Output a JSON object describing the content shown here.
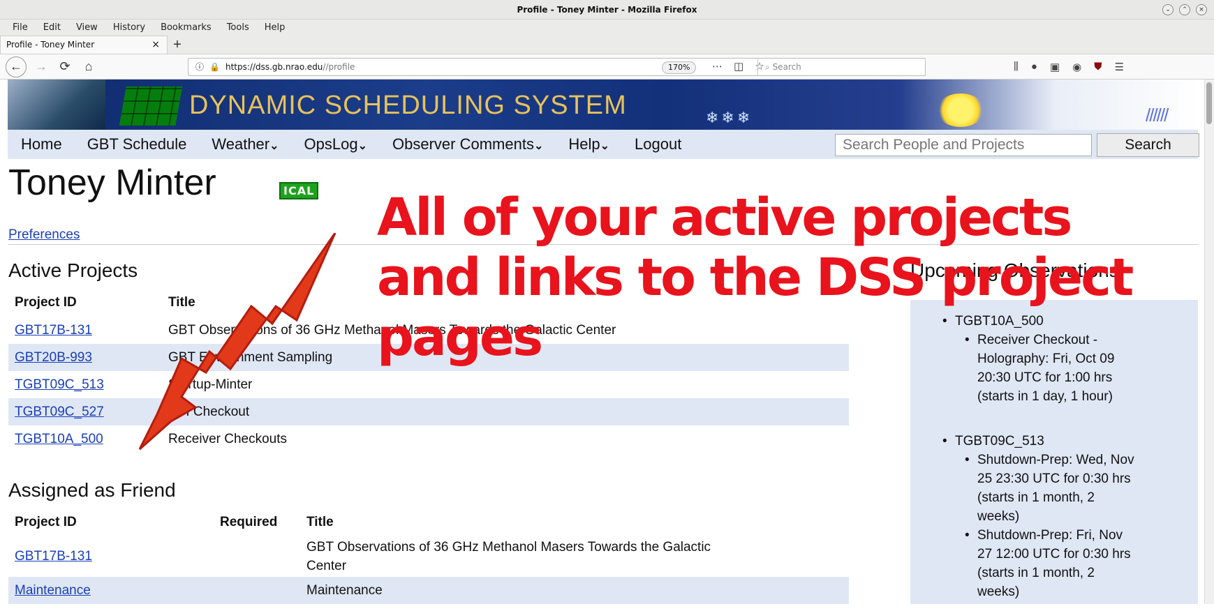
{
  "window": {
    "title": "Profile - Toney Minter - Mozilla Firefox"
  },
  "menubar": [
    "File",
    "Edit",
    "View",
    "History",
    "Bookmarks",
    "Tools",
    "Help"
  ],
  "tab": {
    "label": "Profile - Toney Minter",
    "close": "×",
    "new": "+"
  },
  "navbar": {
    "url_host": "https://dss.gb.nrao.edu",
    "url_path": "//profile",
    "zoom": "170%",
    "search_placeholder": "Search"
  },
  "banner": {
    "title": "DYNAMIC SCHEDULING SYSTEM"
  },
  "site_nav": {
    "home": "Home",
    "gbt_schedule": "GBT Schedule",
    "weather": "Weather",
    "opslog": "OpsLog",
    "observer_comments": "Observer Comments",
    "help": "Help",
    "logout": "Logout",
    "search_placeholder": "Search People and Projects",
    "search_button": "Search"
  },
  "profile": {
    "name": "Toney Minter",
    "ical_badge": "ICAL",
    "preferences": "Preferences"
  },
  "active_projects": {
    "heading": "Active Projects",
    "headers": [
      "Project ID",
      "Title"
    ],
    "rows": [
      {
        "id": "GBT17B-131",
        "title": "GBT Observations of 36 GHz Methanol Masers Towards the Galactic Center"
      },
      {
        "id": "GBT20B-993",
        "title": "GBT Environment Sampling"
      },
      {
        "id": "TGBT09C_513",
        "title": "Startup-Minter"
      },
      {
        "id": "TGBT09C_527",
        "title": "RFI Checkout"
      },
      {
        "id": "TGBT10A_500",
        "title": "Receiver Checkouts"
      }
    ]
  },
  "friend_projects": {
    "heading": "Assigned as Friend",
    "headers": [
      "Project ID",
      "Required",
      "Title"
    ],
    "rows": [
      {
        "id": "GBT17B-131",
        "required": "",
        "title_line1": "GBT Observations of 36 GHz Methanol Masers Towards the Galactic",
        "title_line2": "Center"
      },
      {
        "id": "Maintenance",
        "required": "",
        "title_line1": "Maintenance",
        "title_line2": ""
      }
    ]
  },
  "upcoming": {
    "heading": "Upcoming Observations",
    "groups": [
      {
        "project": "TGBT10A_500",
        "items": [
          "Receiver Checkout - Holography: Fri, Oct 09 20:30 UTC for 1:00 hrs (starts in 1 day, 1 hour)"
        ]
      },
      {
        "project": "TGBT09C_513",
        "items": [
          "Shutdown-Prep: Wed, Nov 25 23:30 UTC for 0:30 hrs (starts in 1 month, 2 weeks)",
          "Shutdown-Prep: Fri, Nov 27 12:00 UTC for 0:30 hrs (starts in 1 month, 2 weeks)"
        ]
      }
    ]
  },
  "annotation": {
    "text": "All of your active projects and links to the DSS project pages"
  }
}
